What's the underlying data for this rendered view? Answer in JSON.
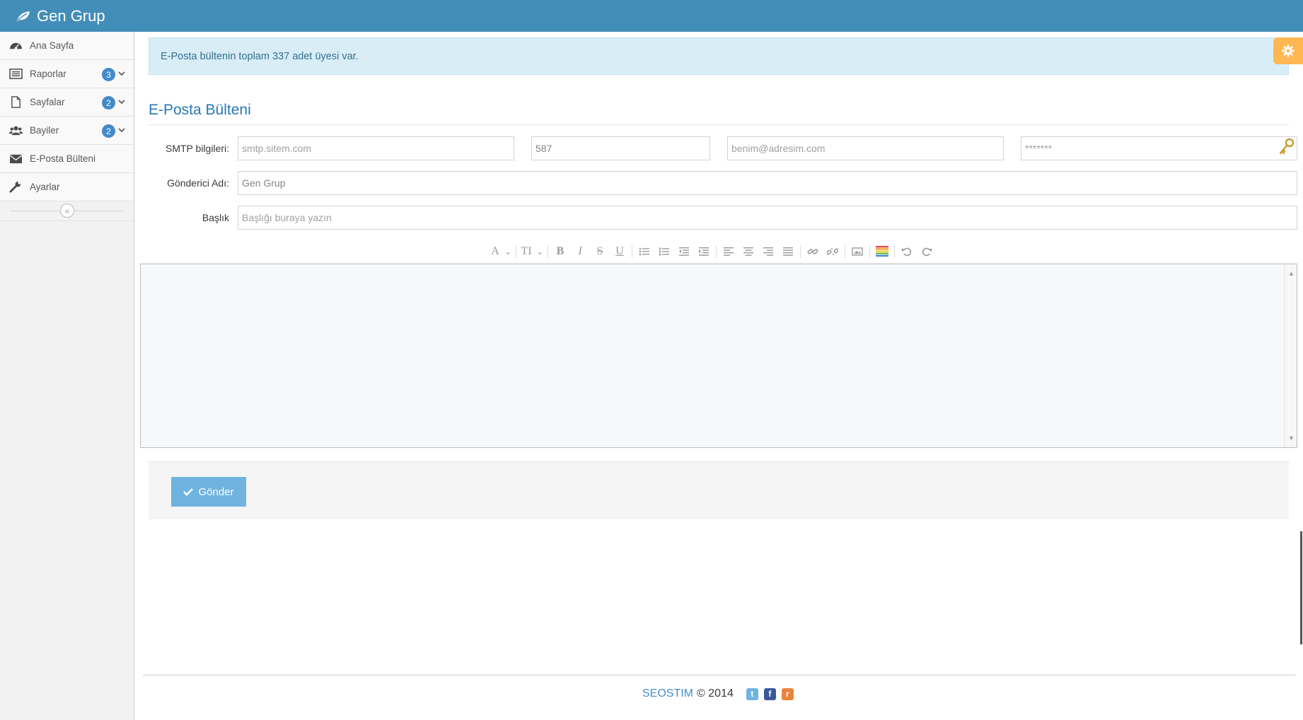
{
  "navbar": {
    "brand": "Gen Grup",
    "brand_icon": "leaf-icon"
  },
  "sidebar": {
    "items": [
      {
        "label": "Ana Sayfa",
        "icon": "dashboard-icon",
        "badge": null,
        "has_submenu": false
      },
      {
        "label": "Raporlar",
        "icon": "list-icon",
        "badge": "3",
        "has_submenu": true
      },
      {
        "label": "Sayfalar",
        "icon": "file-icon",
        "badge": "2",
        "has_submenu": true
      },
      {
        "label": "Bayiler",
        "icon": "users-icon",
        "badge": "2",
        "has_submenu": true
      },
      {
        "label": "E-Posta Bülteni",
        "icon": "envelope-icon",
        "badge": null,
        "has_submenu": false
      },
      {
        "label": "Ayarlar",
        "icon": "wrench-icon",
        "badge": null,
        "has_submenu": false
      }
    ],
    "collapse_glyph": "«"
  },
  "alert": {
    "text": "E-Posta bültenin toplam 337 adet üyesi var.",
    "close": "×"
  },
  "page": {
    "title": "E-Posta Bülteni"
  },
  "form": {
    "smtp_label": "SMTP bilgileri:",
    "smtp_host_placeholder": "smtp.sitem.com",
    "smtp_port_value": "587",
    "smtp_email_placeholder": "benim@adresim.com",
    "smtp_password_placeholder": "*******",
    "sender_label": "Gönderici Adı:",
    "sender_value": "Gen Grup",
    "subject_label": "Başlık",
    "subject_placeholder": "Başlığı buraya yazın"
  },
  "toolbar": {
    "font_glyph": "A",
    "size_glyph": "TI",
    "bold": "B",
    "italic": "I",
    "strike": "S",
    "underline": "U",
    "arrow_glyph": "⌄",
    "scroll_up": "▲",
    "scroll_down": "▼"
  },
  "actions": {
    "send_label": "Gönder"
  },
  "footer": {
    "brand": "SEOSTIM",
    "copyright": "© 2014",
    "twitter_glyph": "t",
    "facebook_glyph": "f",
    "rss_glyph": "r"
  },
  "colors": {
    "navbar": "#438eb9",
    "badge": "#428bca",
    "button": "#6fb3e0",
    "title": "#2679b5",
    "alert_bg": "#d9edf7",
    "settings": "#ffb752",
    "twitter": "#6fb3e0",
    "facebook": "#3b5998",
    "rss": "#e8843c"
  }
}
